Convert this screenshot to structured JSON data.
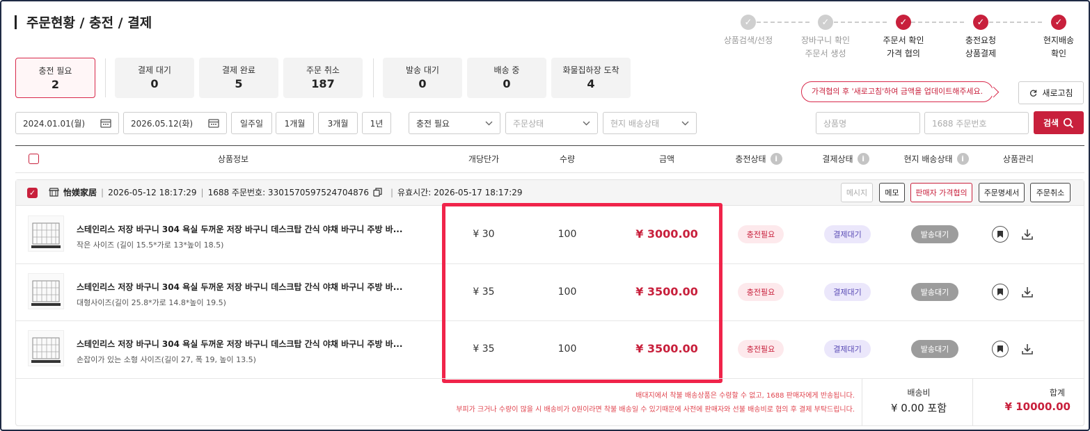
{
  "header": {
    "title": "주문현황 / 충전 / 결제"
  },
  "steps": [
    {
      "line1": "상품검색/선정",
      "line2": "",
      "state": "done"
    },
    {
      "line1": "장바구니 확인",
      "line2": "주문서 생성",
      "state": "done"
    },
    {
      "line1": "주문서 확인",
      "line2": "가격 협의",
      "state": "active"
    },
    {
      "line1": "충전요청",
      "line2": "상품결제",
      "state": "active"
    },
    {
      "line1": "현지배송",
      "line2": "확인",
      "state": "active"
    }
  ],
  "status_cards": [
    {
      "label": "충전 필요",
      "count": "2",
      "active": true
    },
    {
      "label": "결제 대기",
      "count": "0"
    },
    {
      "label": "결제 완료",
      "count": "5"
    },
    {
      "label": "주문 취소",
      "count": "187"
    },
    {
      "label": "발송 대기",
      "count": "0"
    },
    {
      "label": "배송 중",
      "count": "0"
    },
    {
      "label": "화물집하장 도착",
      "count": "4"
    }
  ],
  "tip": "가격협의 후 '새로고침'하여 금액을 업데이트해주세요.",
  "refresh_label": "새로고침",
  "filters": {
    "start_date": "2024.01.01(월)",
    "end_date": "2026.05.12(화)",
    "ranges": [
      "일주일",
      "1개월",
      "3개월",
      "1년"
    ],
    "charge_status": "충전 필요",
    "order_status_placeholder": "주문상태",
    "local_ship_placeholder": "현지 배송상태",
    "product_placeholder": "상품명",
    "order_no_placeholder": "1688 주문번호",
    "search_label": "검색"
  },
  "table": {
    "columns": [
      "상품정보",
      "개당단가",
      "수량",
      "금액",
      "충전상태",
      "결제상태",
      "현지 배송상태",
      "상품관리"
    ]
  },
  "order": {
    "store": "怡媄家居",
    "datetime": "2026-05-12 18:17:29",
    "order_no": "1688 주문번호: 3301570597524704876",
    "valid_until": "유효시간: 2026-05-17 18:17:29",
    "actions": [
      "메시지",
      "메모",
      "판매자 가격협의",
      "주문명세서",
      "주문취소"
    ],
    "items": [
      {
        "name": "스테인리스 저장 바구니 304 욕실 두꺼운 저장 바구니 데스크탑 간식 야채 바구니 주방 바...",
        "option": "작은 사이즈 (길이 15.5*가로 13*높이 18.5)",
        "unit_price": "¥ 30",
        "qty": "100",
        "amount": "¥ 3000.00",
        "charge": "충전필요",
        "pay": "결제대기",
        "ship": "발송대기"
      },
      {
        "name": "스테인리스 저장 바구니 304 욕실 두꺼운 저장 바구니 데스크탑 간식 야채 바구니 주방 바...",
        "option": "대형사이즈(길이 25.8*가로 14.8*높이 19.5)",
        "unit_price": "¥ 35",
        "qty": "100",
        "amount": "¥ 3500.00",
        "charge": "충전필요",
        "pay": "결제대기",
        "ship": "발송대기"
      },
      {
        "name": "스테인리스 저장 바구니 304 욕실 두꺼운 저장 바구니 데스크탑 간식 야채 바구니 주방 바...",
        "option": "손잡이가 있는 소형 사이즈(길이 27, 폭 19, 높이 13.5)",
        "unit_price": "¥ 35",
        "qty": "100",
        "amount": "¥ 3500.00",
        "charge": "충전필요",
        "pay": "결제대기",
        "ship": "발송대기"
      }
    ]
  },
  "footer": {
    "note1": "배대지에서 착불 배송상품은 수령할 수 없고, 1688 판매자에게 반송됩니다.",
    "note2": "부피가 크거나 수량이 많을 시 배송비가 0원이라면 착불 배송일 수 있기때문에 사전에 판매자와 선불 배송비로 협의 후 결제 부탁드립니다.",
    "shipping_label": "배송비",
    "shipping_value": "¥ 0.00 포함",
    "total_label": "합계",
    "total_value": "¥ 10000.00"
  },
  "colors": {
    "accent": "#c8203c",
    "highlight": "#f0244a"
  }
}
